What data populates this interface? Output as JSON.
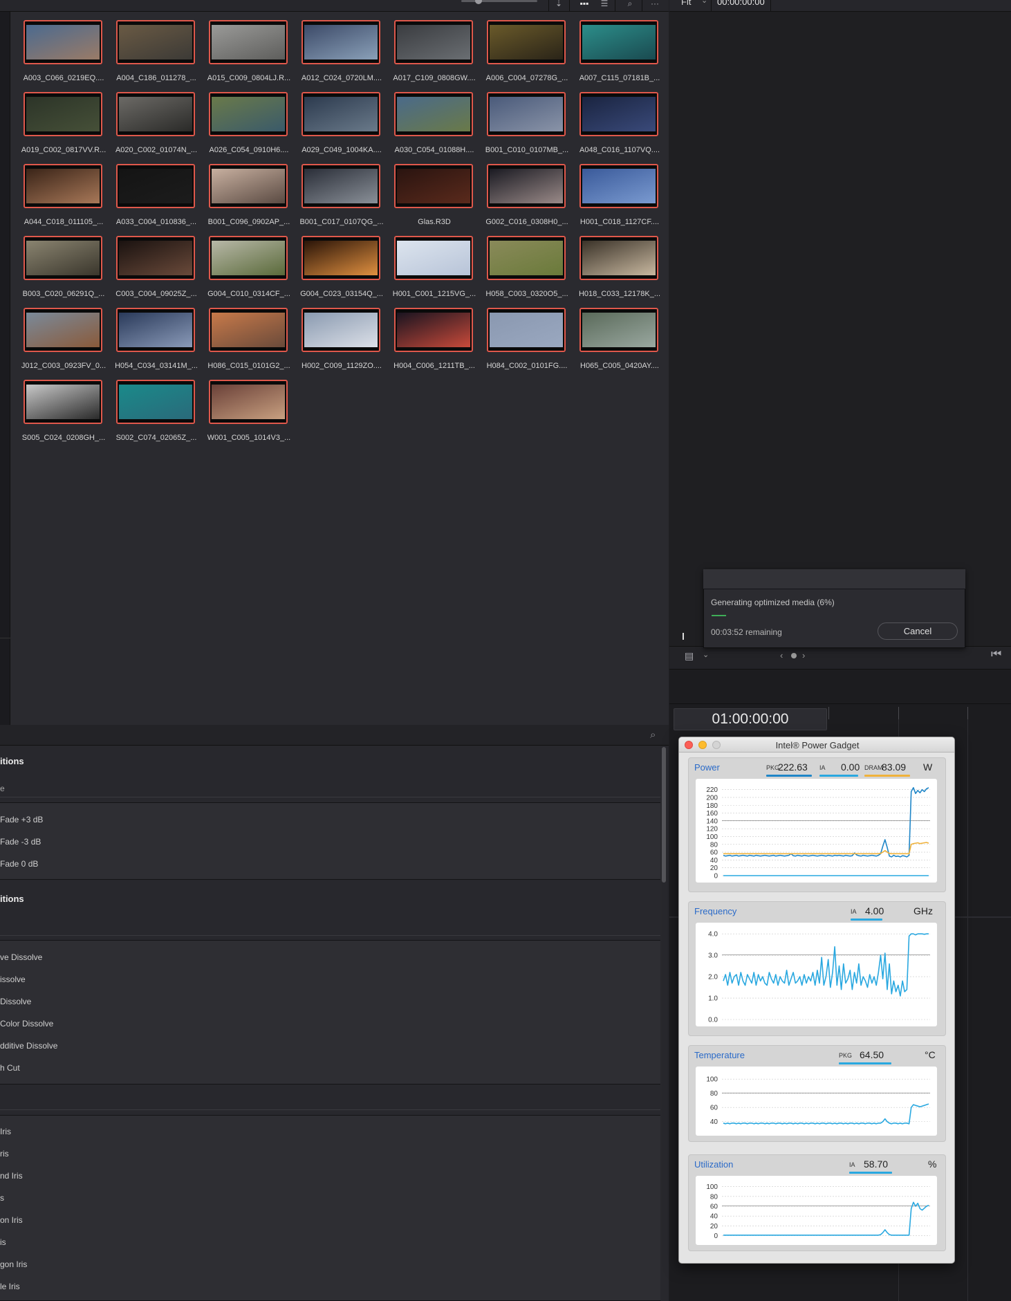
{
  "toolbar": {
    "view_icons": [
      "sort-icon",
      "grid-view-icon",
      "list-view-icon",
      "search-icon",
      "more-icon"
    ]
  },
  "viewer": {
    "zoom": "Fit",
    "timecode_top": "00:00:00:00",
    "timecode_main": "01:00:00:00"
  },
  "clips": [
    {
      "name": "A003_C066_0219EQ....",
      "c1": "#4b6a8f",
      "c2": "#9a7b67"
    },
    {
      "name": "A004_C186_011278_...",
      "c1": "#6a5a44",
      "c2": "#3c3a36"
    },
    {
      "name": "A015_C009_0804LJ.R...",
      "c1": "#9a9a98",
      "c2": "#5e5e5c"
    },
    {
      "name": "A012_C024_0720LM....",
      "c1": "#3c4a68",
      "c2": "#8aa0b8"
    },
    {
      "name": "A017_C109_0808GW....",
      "c1": "#3a3c40",
      "c2": "#6a6e72"
    },
    {
      "name": "A006_C004_07278G_...",
      "c1": "#6a5a2a",
      "c2": "#2a2418"
    },
    {
      "name": "A007_C115_07181B_...",
      "c1": "#2c8e8a",
      "c2": "#1a4a50"
    },
    {
      "name": "A019_C002_0817VV.R...",
      "c1": "#2c3428",
      "c2": "#465038"
    },
    {
      "name": "A020_C002_01074N_...",
      "c1": "#6c6a66",
      "c2": "#2a2a28"
    },
    {
      "name": "A026_C054_0910H6....",
      "c1": "#6a7a4a",
      "c2": "#3a5a6a"
    },
    {
      "name": "A029_C049_1004KA....",
      "c1": "#2c3a4e",
      "c2": "#6a7a8a"
    },
    {
      "name": "A030_C054_01088H....",
      "c1": "#4a6a8a",
      "c2": "#6a7a48"
    },
    {
      "name": "B001_C010_0107MB_...",
      "c1": "#4a5a7a",
      "c2": "#8a94a8"
    },
    {
      "name": "A048_C016_1107VQ....",
      "c1": "#1a2440",
      "c2": "#3a4a7a"
    },
    {
      "name": "A044_C018_011105_...",
      "c1": "#3a2418",
      "c2": "#a87858"
    },
    {
      "name": "A033_C004_010836_...",
      "c1": "#141414",
      "c2": "#1c1c1c"
    },
    {
      "name": "B001_C096_0902AP_...",
      "c1": "#c8b0a0",
      "c2": "#5a4a42"
    },
    {
      "name": "B001_C017_0107QG_...",
      "c1": "#2a2e38",
      "c2": "#8a9098"
    },
    {
      "name": "Glas.R3D",
      "c1": "#2a1410",
      "c2": "#5a2a1c"
    },
    {
      "name": "G002_C016_0308H0_...",
      "c1": "#1a1a22",
      "c2": "#9a8a88"
    },
    {
      "name": "H001_C018_1127CF....",
      "c1": "#3a5a9a",
      "c2": "#7a9ad0"
    },
    {
      "name": "B003_C020_06291Q_...",
      "c1": "#8a8470",
      "c2": "#3a362c"
    },
    {
      "name": "C003_C004_09025Z_...",
      "c1": "#1a1210",
      "c2": "#6a4a3a"
    },
    {
      "name": "G004_C010_0314CF_...",
      "c1": "#b8b8a8",
      "c2": "#5a6a3a"
    },
    {
      "name": "G004_C023_03154Q_...",
      "c1": "#2a1408",
      "c2": "#e09040"
    },
    {
      "name": "H001_C001_1215VG_...",
      "c1": "#dce4ee",
      "c2": "#b8c4d8"
    },
    {
      "name": "H058_C003_0320O5_...",
      "c1": "#8a8a5a",
      "c2": "#6a7a3a"
    },
    {
      "name": "H018_C033_12178K_...",
      "c1": "#3a3228",
      "c2": "#c8b8a0"
    },
    {
      "name": "J012_C003_0923FV_0...",
      "c1": "#7a8a9a",
      "c2": "#8a5a3a"
    },
    {
      "name": "H054_C034_03141M_...",
      "c1": "#2a3a5a",
      "c2": "#8a9ab8"
    },
    {
      "name": "H086_C015_0101G2_...",
      "c1": "#c87a4a",
      "c2": "#6a4a3a"
    },
    {
      "name": "H002_C009_1129ZO....",
      "c1": "#8a9ab0",
      "c2": "#dce0e8"
    },
    {
      "name": "H004_C006_1211TB_...",
      "c1": "#1a1420",
      "c2": "#c84a3a"
    },
    {
      "name": "H084_C002_0101FG....",
      "c1": "#8a98b0",
      "c2": "#9aa8c0"
    },
    {
      "name": "H065_C005_0420AY....",
      "c1": "#5a6a5a",
      "c2": "#9aa8a0"
    },
    {
      "name": "S005_C024_0208GH_...",
      "c1": "#c8c8c8",
      "c2": "#2a2a2a"
    },
    {
      "name": "S002_C074_02065Z_...",
      "c1": "#1a8a8a",
      "c2": "#2a6a7a"
    },
    {
      "name": "W001_C005_1014V3_...",
      "c1": "#6a4038",
      "c2": "#c8a080"
    }
  ],
  "effects": {
    "audio_heading": "itions",
    "audio_sub": "e",
    "audio_items": [
      "Fade +3 dB",
      "Fade -3 dB",
      "Fade 0 dB"
    ],
    "video_heading": "itions",
    "dissolve_items": [
      "ve Dissolve",
      "issolve",
      "Dissolve",
      " Color Dissolve",
      "dditive Dissolve",
      "h Cut"
    ],
    "iris_items": [
      "Iris",
      "ris",
      "nd Iris",
      "s",
      "on Iris",
      "is",
      "gon Iris",
      "le Iris"
    ]
  },
  "progress_dialog": {
    "message": "Generating optimized media (6%)",
    "progress": 0.06,
    "remaining": "00:03:52 remaining",
    "cancel_label": "Cancel"
  },
  "power_gadget": {
    "title": "Intel® Power Gadget",
    "power": {
      "label": "Power",
      "pkg_label": "PKG",
      "pkg": "222.63",
      "ia_label": "IA",
      "ia": "0.00",
      "dram_label": "DRAM",
      "dram": "83.09",
      "unit": "W"
    },
    "frequency": {
      "label": "Frequency",
      "ia_label": "IA",
      "ia": "4.00",
      "unit": "GHz"
    },
    "temperature": {
      "label": "Temperature",
      "pkg_label": "PKG",
      "pkg": "64.50",
      "unit": "°C"
    },
    "utilization": {
      "label": "Utilization",
      "ia_label": "IA",
      "ia": "58.70",
      "unit": "%"
    }
  },
  "chart_data": [
    {
      "type": "line",
      "title": "Power",
      "y_ticks": [
        0,
        20,
        40,
        60,
        80,
        100,
        120,
        140,
        160,
        180,
        200,
        220
      ],
      "ylim": [
        0,
        230
      ],
      "series": [
        {
          "name": "PKG",
          "color": "#1f86c8",
          "values": [
            52,
            50,
            51,
            52,
            50,
            51,
            52,
            50,
            51,
            52,
            51,
            50,
            52,
            51,
            50,
            52,
            51,
            50,
            51,
            52,
            51,
            50,
            51,
            52,
            50,
            51,
            52,
            51,
            50,
            51,
            52,
            56,
            51,
            50,
            52,
            51,
            50,
            52,
            51,
            50,
            51,
            52,
            51,
            50,
            51,
            52,
            51,
            50,
            52,
            51,
            50,
            52,
            51,
            52,
            51,
            50,
            52,
            51,
            50,
            51,
            58,
            53,
            51,
            50,
            52,
            51,
            50,
            51,
            52,
            51,
            50,
            52,
            56,
            75,
            92,
            72,
            50,
            48,
            52,
            49,
            50,
            48,
            51,
            50,
            48,
            52,
            215,
            225,
            210,
            218,
            212,
            220,
            215,
            222,
            225
          ]
        },
        {
          "name": "IA",
          "color": "#29a8e0",
          "values": [
            0,
            0,
            0,
            0,
            0,
            0,
            0,
            0,
            0,
            0,
            0,
            0,
            0,
            0,
            0,
            0,
            0,
            0,
            0,
            0,
            0,
            0,
            0,
            0,
            0,
            0,
            0,
            0,
            0,
            0,
            0,
            0,
            0,
            0,
            0,
            0,
            0,
            0,
            0,
            0,
            0,
            0,
            0,
            0,
            0,
            0,
            0,
            0,
            0,
            0,
            0,
            0,
            0,
            0,
            0,
            0,
            0,
            0,
            0,
            0,
            0,
            0,
            0,
            0,
            0,
            0,
            0,
            0,
            0,
            0,
            0,
            0,
            0,
            0,
            0,
            0,
            0,
            0,
            0,
            0,
            0,
            0,
            0,
            0,
            0,
            0,
            0,
            0,
            0,
            0,
            0,
            0,
            0,
            0,
            0
          ]
        },
        {
          "name": "DRAM",
          "color": "#f0b23a",
          "values": [
            56,
            56,
            56,
            56,
            56,
            56,
            56,
            56,
            56,
            56,
            56,
            56,
            56,
            56,
            56,
            56,
            56,
            56,
            56,
            56,
            56,
            56,
            56,
            56,
            56,
            56,
            56,
            56,
            56,
            56,
            56,
            56,
            56,
            56,
            56,
            56,
            56,
            56,
            56,
            56,
            56,
            56,
            56,
            56,
            56,
            56,
            56,
            56,
            56,
            56,
            56,
            56,
            56,
            56,
            56,
            56,
            56,
            56,
            56,
            56,
            56,
            56,
            56,
            56,
            56,
            56,
            56,
            56,
            56,
            56,
            56,
            56,
            57,
            60,
            64,
            60,
            57,
            56,
            56,
            56,
            56,
            56,
            56,
            56,
            56,
            56,
            80,
            82,
            83,
            84,
            82,
            83,
            84,
            85,
            83
          ]
        }
      ]
    },
    {
      "type": "line",
      "title": "Frequency",
      "y_ticks": [
        0.0,
        1.0,
        2.0,
        3.0,
        4.0
      ],
      "ylim": [
        0,
        4.2
      ],
      "series": [
        {
          "name": "IA",
          "color": "#29a8e0",
          "values": [
            1.8,
            2.1,
            1.6,
            2.2,
            1.7,
            2.0,
            2.1,
            1.6,
            2.2,
            1.8,
            1.6,
            2.1,
            1.9,
            1.7,
            2.2,
            1.6,
            2.1,
            1.8,
            2.0,
            1.7,
            1.6,
            2.2,
            1.9,
            1.7,
            2.1,
            1.6,
            2.0,
            1.8,
            1.7,
            2.3,
            1.6,
            1.9,
            2.2,
            1.7,
            1.8,
            2.0,
            1.6,
            2.1,
            1.7,
            2.0,
            1.8,
            2.2,
            1.6,
            2.3,
            1.7,
            2.9,
            1.6,
            2.0,
            2.8,
            1.5,
            2.2,
            3.4,
            1.6,
            2.5,
            1.4,
            2.6,
            1.7,
            1.9,
            2.3,
            1.4,
            2.2,
            1.7,
            2.6,
            1.6,
            2.0,
            1.8,
            1.5,
            2.1,
            1.7,
            2.0,
            1.6,
            2.2,
            3.0,
            1.9,
            3.1,
            1.4,
            2.6,
            1.2,
            1.8,
            1.3,
            1.6,
            1.1,
            1.8,
            1.3,
            1.4,
            3.9,
            4.0,
            4.0,
            3.95,
            4.0,
            4.0,
            4.0,
            3.98,
            4.0,
            4.0
          ]
        }
      ]
    },
    {
      "type": "line",
      "title": "Temperature",
      "y_ticks": [
        40,
        60,
        80,
        100
      ],
      "ylim": [
        30,
        108
      ],
      "series": [
        {
          "name": "PKG",
          "color": "#29a8e0",
          "values": [
            38,
            37,
            38,
            37,
            38,
            38,
            37,
            38,
            37,
            38,
            38,
            37,
            38,
            38,
            37,
            38,
            37,
            38,
            38,
            37,
            38,
            37,
            38,
            38,
            37,
            38,
            38,
            37,
            38,
            37,
            38,
            38,
            37,
            38,
            37,
            38,
            38,
            37,
            38,
            37,
            38,
            38,
            37,
            38,
            37,
            38,
            38,
            37,
            38,
            38,
            37,
            38,
            37,
            38,
            38,
            37,
            38,
            37,
            38,
            38,
            37,
            38,
            37,
            38,
            38,
            37,
            38,
            38,
            37,
            38,
            37,
            38,
            38,
            40,
            44,
            40,
            38,
            37,
            38,
            38,
            37,
            38,
            37,
            38,
            38,
            37,
            60,
            64,
            63,
            62,
            61,
            62,
            63,
            64,
            65
          ]
        }
      ]
    },
    {
      "type": "line",
      "title": "Utilization",
      "y_ticks": [
        0,
        20,
        40,
        60,
        80,
        100
      ],
      "ylim": [
        -5,
        108
      ],
      "series": [
        {
          "name": "IA",
          "color": "#29a8e0",
          "values": [
            1,
            1,
            1,
            1,
            1,
            1,
            1,
            1,
            1,
            1,
            1,
            1,
            1,
            1,
            1,
            1,
            1,
            1,
            1,
            1,
            1,
            1,
            1,
            1,
            1,
            1,
            1,
            1,
            1,
            1,
            1,
            1,
            1,
            1,
            1,
            1,
            1,
            1,
            1,
            1,
            1,
            1,
            1,
            1,
            1,
            1,
            1,
            1,
            1,
            1,
            1,
            1,
            1,
            1,
            1,
            1,
            1,
            1,
            1,
            1,
            1,
            1,
            1,
            1,
            1,
            1,
            1,
            1,
            1,
            1,
            1,
            1,
            2,
            6,
            12,
            6,
            2,
            1,
            1,
            1,
            1,
            1,
            1,
            1,
            1,
            1,
            55,
            68,
            60,
            66,
            55,
            52,
            56,
            60,
            62
          ]
        }
      ]
    }
  ]
}
